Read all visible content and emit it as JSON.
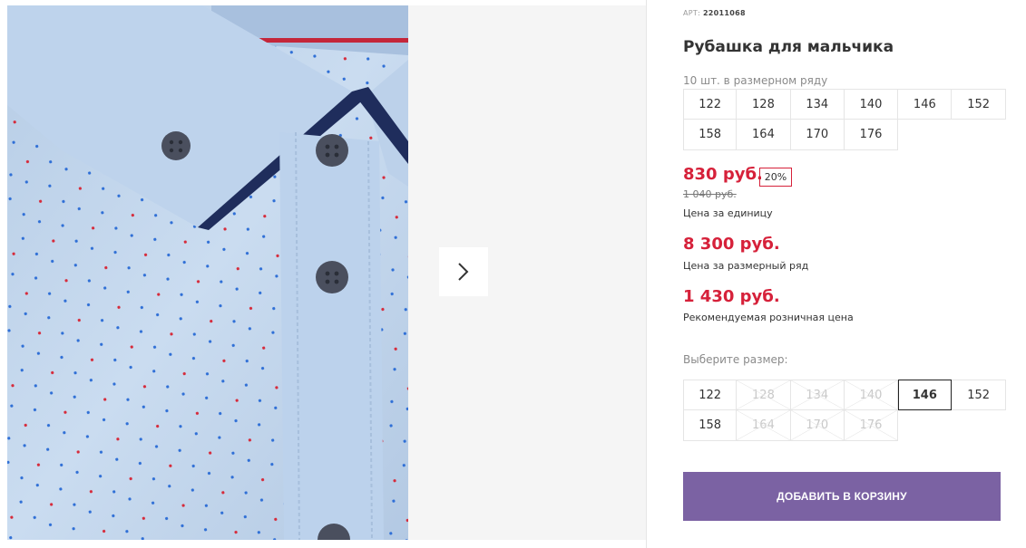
{
  "product": {
    "art_label": "АРТ:",
    "art_value": "22011068",
    "title": "Рубашка для мальчика",
    "pcs_in_range": "10 шт. в размерном ряду"
  },
  "range_sizes": [
    "122",
    "128",
    "134",
    "140",
    "146",
    "152",
    "158",
    "164",
    "170",
    "176"
  ],
  "prices": {
    "unit_price": "830 руб.",
    "discount_badge": "20%",
    "old_price": "1 040 руб.",
    "unit_label": "Цена за единицу",
    "range_price": "8 300 руб.",
    "range_label": "Цена за размерный ряд",
    "retail_price": "1 430 руб.",
    "retail_label": "Рекомендуемая розничная цена"
  },
  "size_select": {
    "label": "Выберите размер:",
    "options": [
      {
        "size": "122",
        "available": true,
        "selected": false
      },
      {
        "size": "128",
        "available": false,
        "selected": false
      },
      {
        "size": "134",
        "available": false,
        "selected": false
      },
      {
        "size": "140",
        "available": false,
        "selected": false
      },
      {
        "size": "146",
        "available": true,
        "selected": true
      },
      {
        "size": "152",
        "available": true,
        "selected": false
      },
      {
        "size": "158",
        "available": true,
        "selected": false
      },
      {
        "size": "164",
        "available": false,
        "selected": false
      },
      {
        "size": "170",
        "available": false,
        "selected": false
      },
      {
        "size": "176",
        "available": false,
        "selected": false
      }
    ]
  },
  "cart_button": "ДОБАВИТЬ В КОРЗИНУ",
  "icons": {
    "next": "chevron-right-icon"
  },
  "colors": {
    "price": "#d6213a",
    "button": "#7b62a3",
    "shirt": "#c5d9ee",
    "collar": "#1f2d5c"
  }
}
